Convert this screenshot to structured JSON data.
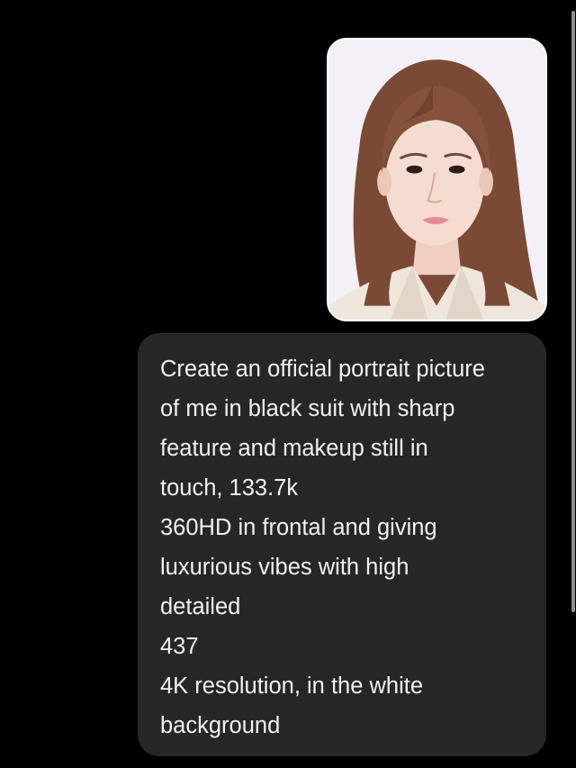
{
  "message": {
    "lines": [
      "Create an official portrait picture",
      "of me in black suit with sharp",
      "feature and makeup still in",
      "touch, 133.7k",
      "360HD in frontal and giving",
      "luxurious vibes with high",
      "detailed",
      "437",
      "4K resolution, in the white",
      "background"
    ]
  },
  "colors": {
    "background": "#000000",
    "bubble": "#262626",
    "text": "#f2f2f2",
    "scrollbar": "#8e8e8e"
  },
  "icons": {
    "attachment": "portrait-photo"
  },
  "scroll": {
    "position_fraction": 0.0
  }
}
